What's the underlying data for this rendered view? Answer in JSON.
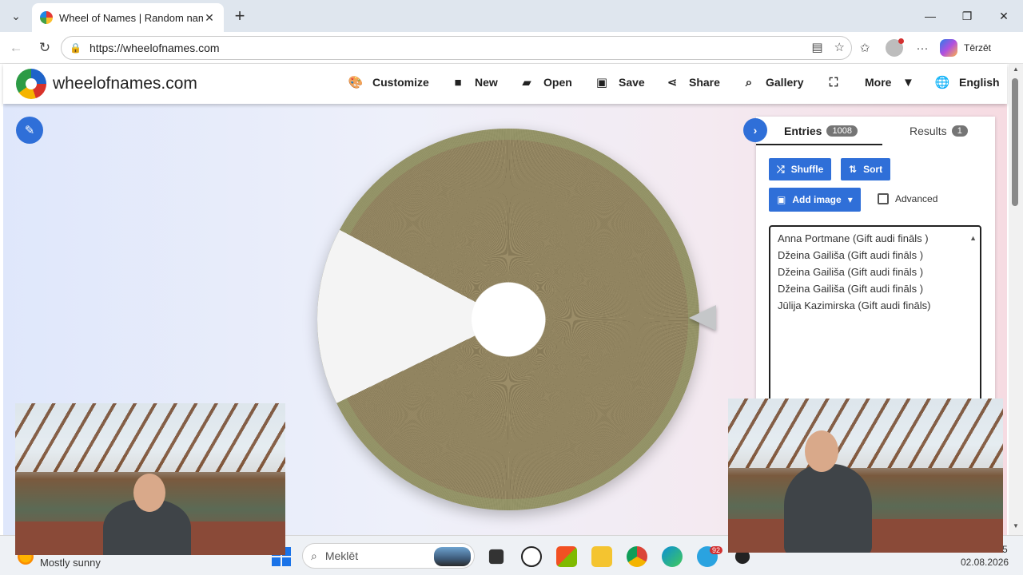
{
  "browser": {
    "tab_title": "Wheel of Names | Random name p",
    "url": "https://wheelofnames.com",
    "copilot_label": "Tērzēt"
  },
  "site": {
    "logo_text": "wheelofnames.com",
    "menu": [
      {
        "label": "Customize",
        "icon": "palette-icon"
      },
      {
        "label": "New",
        "icon": "file-icon"
      },
      {
        "label": "Open",
        "icon": "folder-open-icon"
      },
      {
        "label": "Save",
        "icon": "floppy-disk-icon"
      },
      {
        "label": "Share",
        "icon": "share-icon"
      },
      {
        "label": "Gallery",
        "icon": "search-icon"
      },
      {
        "label": "",
        "icon": "fullscreen-icon"
      },
      {
        "label": "More",
        "icon": "caret-down-icon"
      },
      {
        "label": "English",
        "icon": "globe-icon"
      }
    ]
  },
  "panel": {
    "tabs": [
      {
        "label": "Entries",
        "count": "1008"
      },
      {
        "label": "Results",
        "count": "1"
      }
    ],
    "buttons": {
      "shuffle": "Shuffle",
      "sort": "Sort",
      "add_image": "Add image"
    },
    "advanced_label": "Advanced",
    "entries": [
      "Anna Portmane (Gift audi fināls )",
      "Džeina Gailiša (Gift audi fināls )",
      "Džeina Gailiša (Gift audi fināls )",
      "Džeina Gailiša (Gift audi fināls )",
      "Jūlija Kazimirska (Gift audi fināls)"
    ]
  },
  "taskbar": {
    "weather": "Mostly sunny",
    "search_placeholder": "Meklēt",
    "date": "02.08.2026",
    "time_partial": "5",
    "telegram_badge": "92"
  },
  "colors": {
    "accent": "#2f6fd8",
    "wheel": "#8f8260"
  }
}
